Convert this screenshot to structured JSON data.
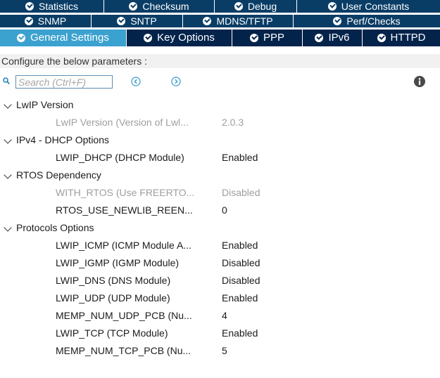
{
  "tabs": {
    "row1": [
      "Statistics",
      "Checksum",
      "Debug",
      "User Constants"
    ],
    "row2": [
      "SNMP",
      "SNTP",
      "MDNS/TFTP",
      "Perf/Checks"
    ],
    "row3": [
      "General Settings",
      "Key Options",
      "PPP",
      "IPv6",
      "HTTPD"
    ],
    "active": "General Settings"
  },
  "hint": "Configure the below parameters :",
  "search": {
    "placeholder": "Search (Ctrl+F)",
    "value": ""
  },
  "tree": {
    "cat_lwip": "LwIP Version",
    "p_lwip_version": {
      "name": "LwIP Version (Version of Lwl...",
      "value": "2.0.3"
    },
    "cat_ipv4": "IPv4 - DHCP Options",
    "p_lwip_dhcp": {
      "name": "LWIP_DHCP (DHCP Module)",
      "value": "Enabled"
    },
    "cat_rtos": "RTOS Dependency",
    "p_with_rtos": {
      "name": "WITH_RTOS (Use FREERTO...",
      "value": "Disabled"
    },
    "p_rtos_newlib": {
      "name": "RTOS_USE_NEWLIB_REEN...",
      "value": "0"
    },
    "cat_protocols": "Protocols Options",
    "p_icmp": {
      "name": "LWIP_ICMP (ICMP Module A...",
      "value": "Enabled"
    },
    "p_igmp": {
      "name": "LWIP_IGMP (IGMP Module)",
      "value": "Disabled"
    },
    "p_dns": {
      "name": "LWIP_DNS (DNS Module)",
      "value": "Disabled"
    },
    "p_udp": {
      "name": "LWIP_UDP (UDP Module)",
      "value": "Enabled"
    },
    "p_udp_pcb": {
      "name": "MEMP_NUM_UDP_PCB (Nu...",
      "value": "4"
    },
    "p_tcp": {
      "name": "LWIP_TCP (TCP Module)",
      "value": "Enabled"
    },
    "p_tcp_pcb": {
      "name": "MEMP_NUM_TCP_PCB (Nu...",
      "value": "5"
    }
  },
  "icons": {
    "tab": "check-circle-icon",
    "search": "search-icon",
    "prev": "previous-match-icon",
    "next": "next-match-icon",
    "info": "info-icon",
    "expand": "chevron-down-icon"
  },
  "colors": {
    "tab_bg": "#0a3d66",
    "tab_row3_bg": "#03234b",
    "tab_active_bg": "#3ba1cf",
    "accent": "#3498cc",
    "dim_text": "#9e9e9e"
  }
}
